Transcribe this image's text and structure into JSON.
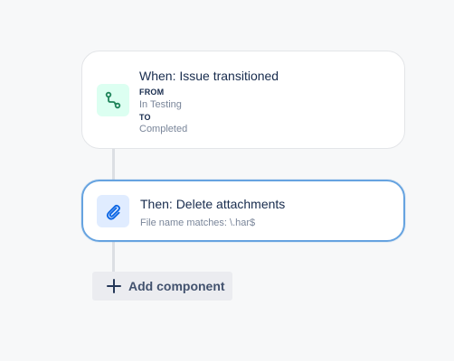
{
  "trigger": {
    "icon": "transition-icon",
    "title": "When: Issue transitioned",
    "from_label": "FROM",
    "from_value": "In Testing",
    "to_label": "TO",
    "to_value": "Completed"
  },
  "action": {
    "icon": "paperclip-icon",
    "title": "Then: Delete attachments",
    "detail": "File name matches: \\.har$"
  },
  "add_component": {
    "label": "Add component"
  },
  "colors": {
    "background": "#f7f8f9",
    "selected_border": "#66a3e0",
    "trigger_icon_bg": "#dcfff1",
    "trigger_icon": "#1f845a",
    "action_icon_bg": "#e0ecff",
    "action_icon": "#0c66e4"
  }
}
